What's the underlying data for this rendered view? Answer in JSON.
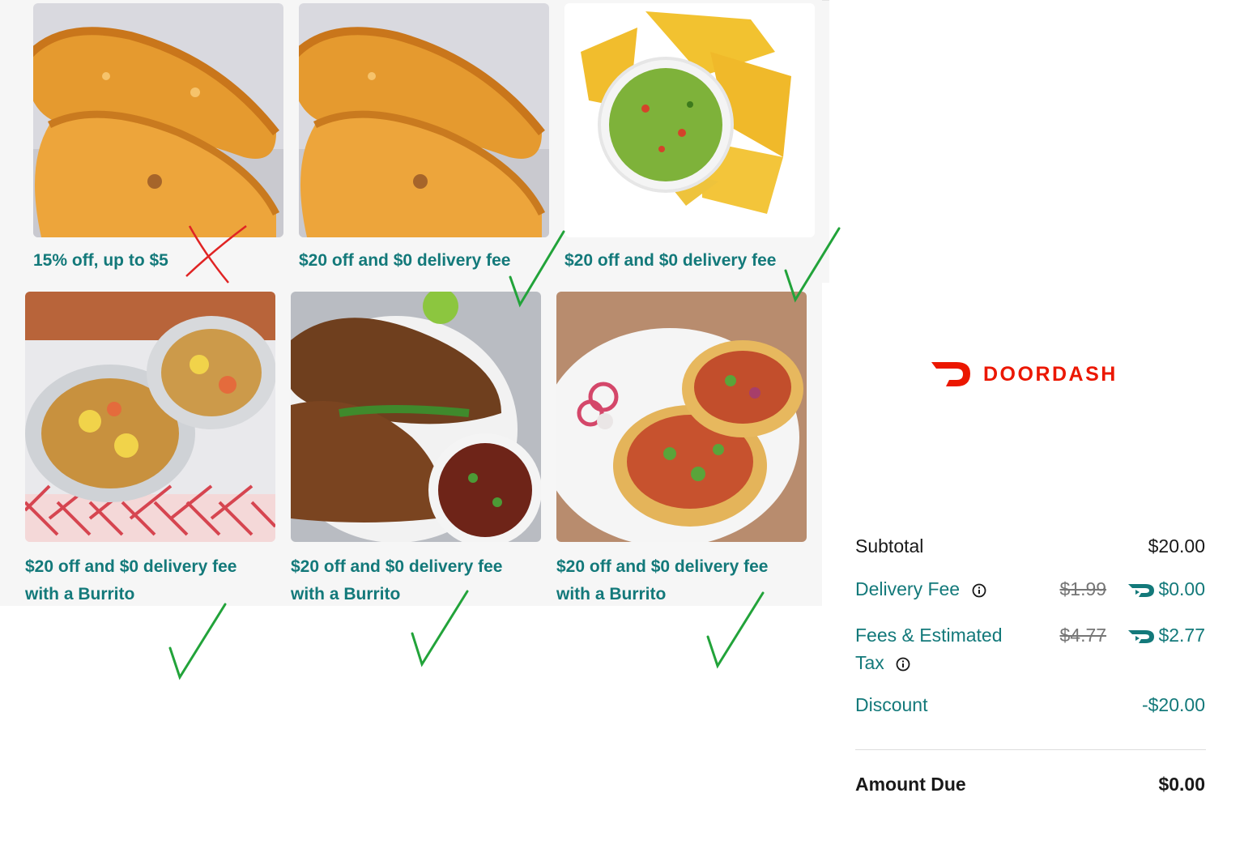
{
  "offers": [
    {
      "line1": "15% off, up to $5",
      "line2": "",
      "image": "empanadas-photo",
      "mark": "red-x"
    },
    {
      "line1": "$20 off and $0 delivery fee",
      "line2": "",
      "image": "empanadas-photo",
      "mark": "green-check"
    },
    {
      "line1": "$20 off and $0 delivery fee",
      "line2": "",
      "image": "guacamole-chips-photo",
      "mark": "green-check"
    },
    {
      "line1": "$20 off and $0 delivery fee",
      "line2": "with a Burrito",
      "image": "burrito-photo",
      "mark": "green-check"
    },
    {
      "line1": "$20 off and $0 delivery fee",
      "line2": "with a Burrito",
      "image": "birria-tacos-photo",
      "mark": "green-check"
    },
    {
      "line1": "$20 off and $0 delivery fee",
      "line2": "with a Burrito",
      "image": "tacos-photo",
      "mark": "green-check"
    }
  ],
  "brand": {
    "name": "DOORDASH",
    "color": "#eb1700"
  },
  "summary": {
    "subtotal_label": "Subtotal",
    "subtotal_value": "$20.00",
    "delivery_label": "Delivery Fee",
    "delivery_original": "$1.99",
    "delivery_value": "$0.00",
    "fees_label_1": "Fees & Estimated",
    "fees_label_2": "Tax",
    "fees_original": "$4.77",
    "fees_value": "$2.77",
    "discount_label": "Discount",
    "discount_value": "-$20.00",
    "amount_due_label": "Amount Due",
    "amount_due_value": "$0.00"
  },
  "colors": {
    "accent_teal": "#13797a",
    "check_green": "#22a33a",
    "x_red": "#e02424"
  }
}
